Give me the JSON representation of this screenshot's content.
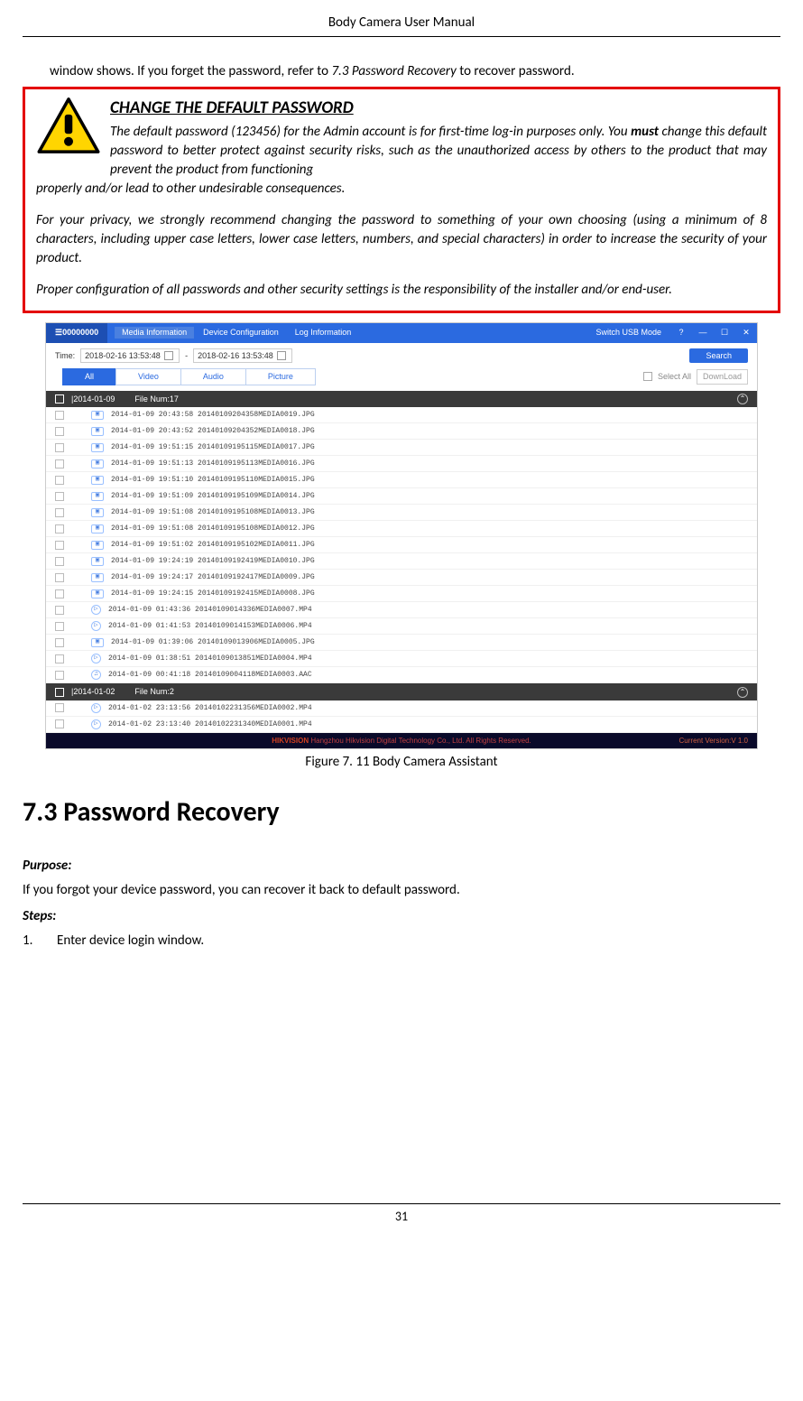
{
  "header": {
    "title": "Body Camera User Manual"
  },
  "intro": {
    "prefix": "window shows. If you forget the password, refer to ",
    "link": "7.3 Password Recovery",
    "suffix": " to recover password."
  },
  "warning": {
    "heading": "CHANGE THE DEFAULT PASSWORD",
    "p1a": "The default password (123456) for the Admin account is for first-time log-in purposes only. You ",
    "p1_must": "must",
    "p1b": " change this default password to better protect against security risks, such as the unauthorized access by others to the product that may prevent the product from functioning properly and/or lead to other undesirable consequences.",
    "p2": "For your privacy, we strongly recommend changing the password to something of your own choosing (using a minimum of 8 characters, including upper case letters, lower case letters, numbers, and special characters) in order to increase the security of your product.",
    "p3": "Proper configuration of all passwords and other security settings is the responsibility of the installer and/or end-user."
  },
  "screenshot": {
    "logo": "00000000",
    "menu": [
      "Media Information",
      "Device Configuration",
      "Log Information"
    ],
    "switch": "Switch USB Mode",
    "time_label": "Time:",
    "time_from": "2018-02-16 13:53:48",
    "time_to": "2018-02-16 13:53:48",
    "search": "Search",
    "tabs": [
      "All",
      "Video",
      "Audio",
      "Picture"
    ],
    "select_all": "Select All",
    "download": "DownLoad",
    "groups": [
      {
        "date": "2014-01-09",
        "filenum": "File Num:17",
        "rows": [
          {
            "icon": "img",
            "text": "2014-01-09 20:43:58 20140109204358MEDIA0019.JPG"
          },
          {
            "icon": "img",
            "text": "2014-01-09 20:43:52 20140109204352MEDIA0018.JPG"
          },
          {
            "icon": "img",
            "text": "2014-01-09 19:51:15 20140109195115MEDIA0017.JPG"
          },
          {
            "icon": "img",
            "text": "2014-01-09 19:51:13 20140109195113MEDIA0016.JPG"
          },
          {
            "icon": "img",
            "text": "2014-01-09 19:51:10 20140109195110MEDIA0015.JPG"
          },
          {
            "icon": "img",
            "text": "2014-01-09 19:51:09 20140109195109MEDIA0014.JPG"
          },
          {
            "icon": "img",
            "text": "2014-01-09 19:51:08 20140109195108MEDIA0013.JPG"
          },
          {
            "icon": "img",
            "text": "2014-01-09 19:51:08 20140109195108MEDIA0012.JPG"
          },
          {
            "icon": "img",
            "text": "2014-01-09 19:51:02 20140109195102MEDIA0011.JPG"
          },
          {
            "icon": "img",
            "text": "2014-01-09 19:24:19 20140109192419MEDIA0010.JPG"
          },
          {
            "icon": "img",
            "text": "2014-01-09 19:24:17 20140109192417MEDIA0009.JPG"
          },
          {
            "icon": "img",
            "text": "2014-01-09 19:24:15 20140109192415MEDIA0008.JPG"
          },
          {
            "icon": "play",
            "text": "2014-01-09 01:43:36 20140109014336MEDIA0007.MP4"
          },
          {
            "icon": "play",
            "text": "2014-01-09 01:41:53 20140109014153MEDIA0006.MP4"
          },
          {
            "icon": "img",
            "text": "2014-01-09 01:39:06 20140109013906MEDIA0005.JPG"
          },
          {
            "icon": "play",
            "text": "2014-01-09 01:38:51 20140109013851MEDIA0004.MP4"
          },
          {
            "icon": "aud",
            "text": "2014-01-09 00:41:18 20140109004118MEDIA0003.AAC"
          }
        ]
      },
      {
        "date": "2014-01-02",
        "filenum": "File Num:2",
        "rows": [
          {
            "icon": "play",
            "text": "2014-01-02 23:13:56 20140102231356MEDIA0002.MP4"
          },
          {
            "icon": "play",
            "text": "2014-01-02 23:13:40 20140102231340MEDIA0001.MP4"
          }
        ]
      }
    ],
    "footer_brand": "HIKVISION",
    "footer_text": " Hangzhou Hikvision Digital Technology Co., Ltd. All Rights Reserved.",
    "footer_ver": "Current Version:V 1.0"
  },
  "figure_caption": "Figure 7. 11 Body Camera Assistant",
  "section": {
    "heading": "7.3    Password Recovery",
    "purpose_label": "Purpose:",
    "purpose_text": "If you forgot your device password, you can recover it back to default password.",
    "steps_label": "Steps:",
    "step1_num": "1.",
    "step1_text": "Enter device login window."
  },
  "page_number": "31"
}
